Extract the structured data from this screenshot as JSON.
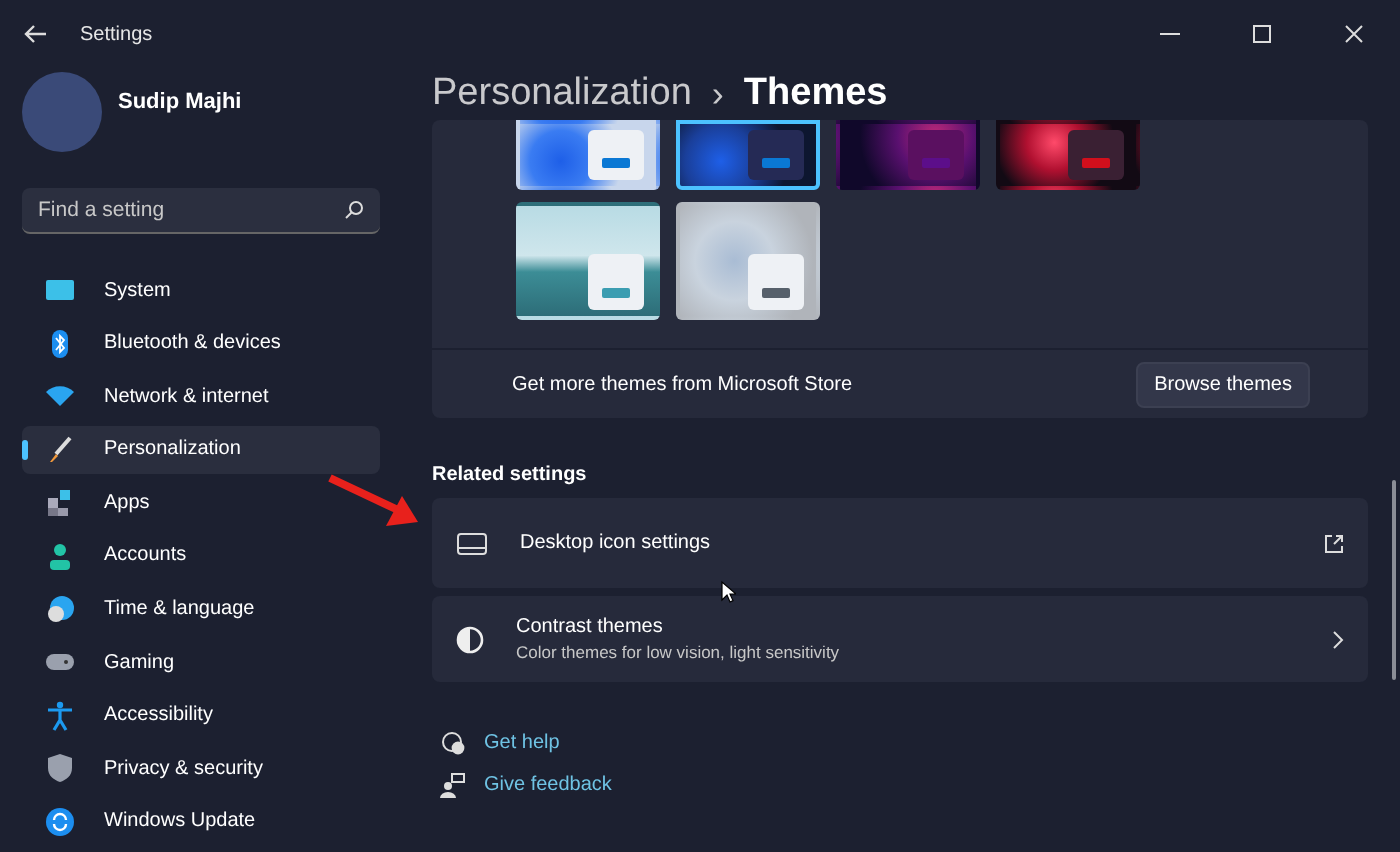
{
  "window": {
    "title": "Settings"
  },
  "user": {
    "name": "Sudip Majhi"
  },
  "search": {
    "placeholder": "Find a setting"
  },
  "sidebar": {
    "items": [
      {
        "label": "System",
        "selected": false
      },
      {
        "label": "Bluetooth & devices",
        "selected": false
      },
      {
        "label": "Network & internet",
        "selected": false
      },
      {
        "label": "Personalization",
        "selected": true
      },
      {
        "label": "Apps",
        "selected": false
      },
      {
        "label": "Accounts",
        "selected": false
      },
      {
        "label": "Time & language",
        "selected": false
      },
      {
        "label": "Gaming",
        "selected": false
      },
      {
        "label": "Accessibility",
        "selected": false
      },
      {
        "label": "Privacy & security",
        "selected": false
      },
      {
        "label": "Windows Update",
        "selected": false
      }
    ]
  },
  "breadcrumb": {
    "parent": "Personalization",
    "separator": "›",
    "current": "Themes"
  },
  "themes": [
    {
      "kind": "bloomlight",
      "selected": false,
      "color": "#0a78d4"
    },
    {
      "kind": "bloomdark",
      "selected": true,
      "color": "#0a78d4"
    },
    {
      "kind": "glow",
      "selected": false,
      "color": "#5c0e8a"
    },
    {
      "kind": "flower",
      "selected": false,
      "color": "#d10f1c"
    },
    {
      "kind": "lake",
      "selected": false,
      "color": "#3b9db1"
    },
    {
      "kind": "flow",
      "selected": false,
      "color": "#56606b"
    }
  ],
  "store": {
    "text": "Get more themes from Microsoft Store",
    "button": "Browse themes"
  },
  "related": {
    "heading": "Related settings",
    "items": [
      {
        "kind": "external",
        "title": "Desktop icon settings"
      },
      {
        "kind": "chevron",
        "title": "Contrast themes",
        "subtitle": "Color themes for low vision, light sensitivity"
      }
    ]
  },
  "help_links": [
    {
      "kind": "help",
      "label": "Get help"
    },
    {
      "kind": "feedback",
      "label": "Give feedback"
    }
  ]
}
